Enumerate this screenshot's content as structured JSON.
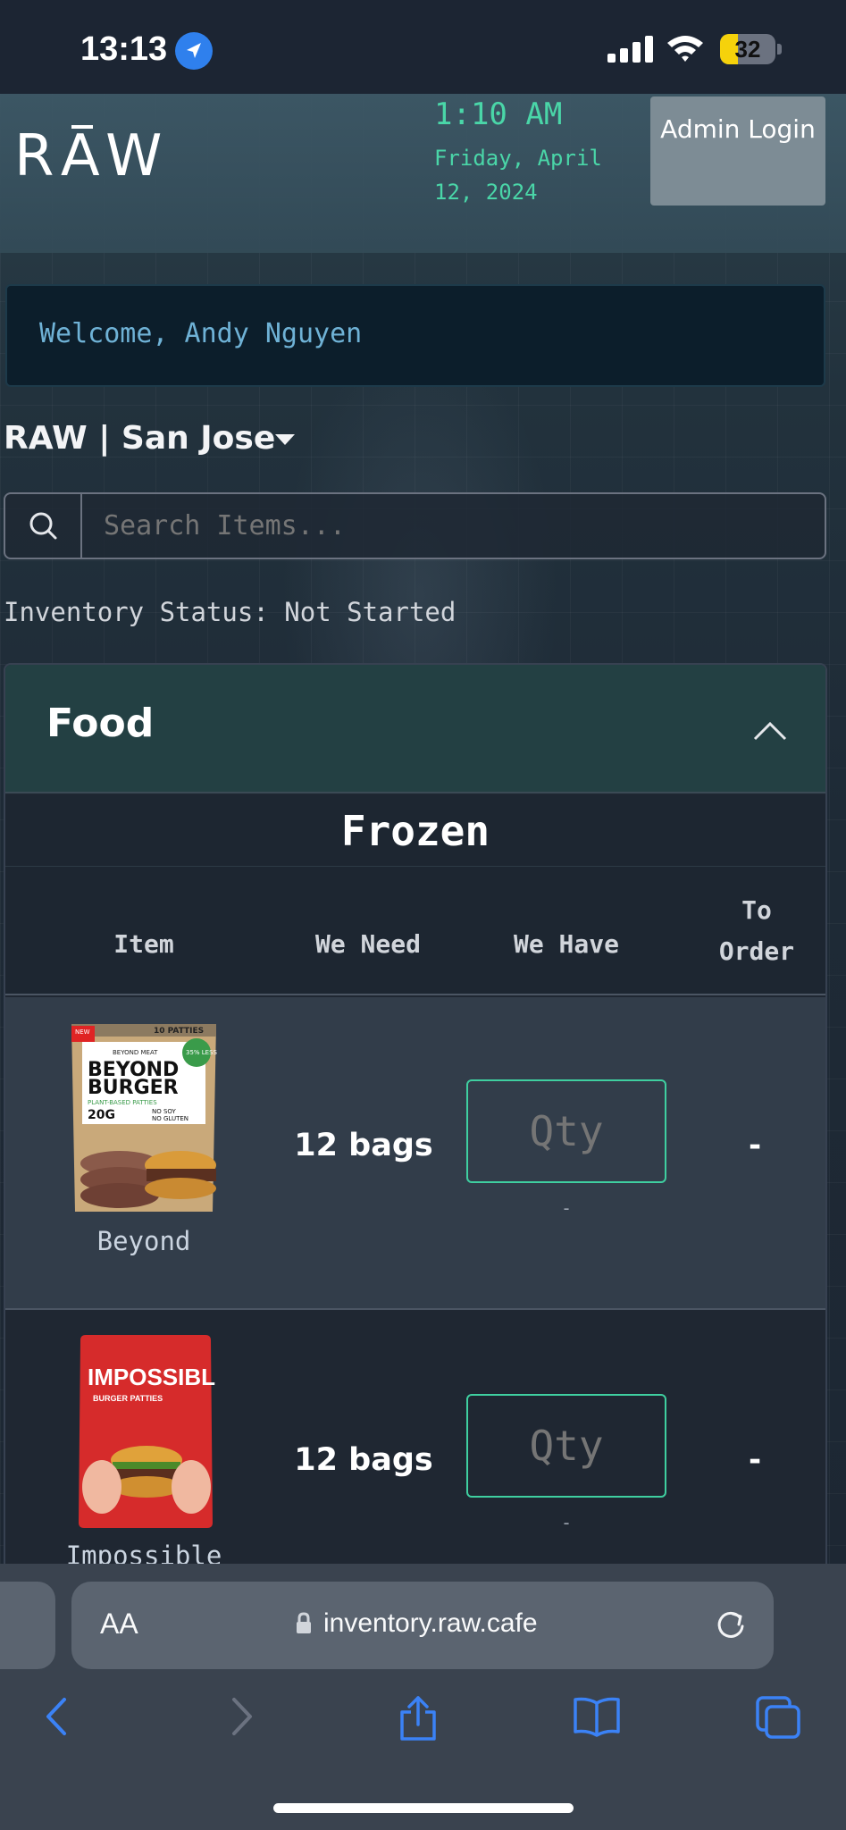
{
  "status_bar": {
    "time": "13:13",
    "battery": "32",
    "battery_level": 0.32,
    "icons": [
      "location-arrow-icon",
      "cellular-signal-icon",
      "wifi-icon",
      "battery-icon"
    ]
  },
  "header": {
    "logo": "RAW",
    "clock": "1:10 AM",
    "date": "Friday, April 12, 2024",
    "admin_button": "Admin Login"
  },
  "welcome": "Welcome, Andy Nguyen",
  "location": {
    "name": "RAW | San Jose",
    "icon": "caret-down-icon"
  },
  "search": {
    "placeholder": "Search Items...",
    "value": "",
    "icon": "search-icon"
  },
  "inventory_status": "Inventory Status: Not Started",
  "category": {
    "title": "Food",
    "expanded": true,
    "icon": "chevron-up-icon",
    "section": "Frozen",
    "columns": [
      "Item",
      "We Need",
      "We Have",
      "To Order"
    ],
    "items": [
      {
        "name": "Beyond",
        "image_text": [
          "NEW",
          "10 PATTIES",
          "BEYOND MEAT",
          "BEYOND",
          "BURGER",
          "PLANT-BASED PATTIES",
          "20G",
          "NO SOY",
          "NO GLUTEN",
          "35% LESS"
        ],
        "we_need": "12 bags",
        "we_have_placeholder": "Qty",
        "we_have_value": "",
        "we_have_sub": "-",
        "to_order": "-"
      },
      {
        "name": "Impossible",
        "image_text": [
          "IMPOSSIBLE",
          "BURGER PATTIES"
        ],
        "we_need": "12 bags",
        "we_have_placeholder": "Qty",
        "we_have_value": "",
        "we_have_sub": "-",
        "to_order": "-"
      }
    ]
  },
  "browser": {
    "text_size": "AA",
    "url": "inventory.raw.cafe",
    "toolbar_icons": [
      "back-icon",
      "forward-icon",
      "share-icon",
      "bookmarks-icon",
      "tabs-icon"
    ]
  },
  "colors": {
    "accent": "#4ad6a8",
    "category_header": "#234043",
    "welcome_text": "#6fb2d6"
  }
}
